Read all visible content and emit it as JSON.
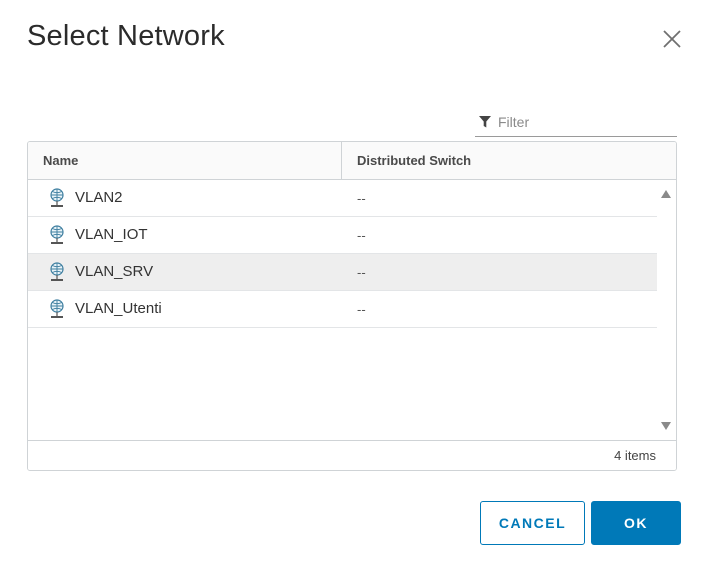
{
  "dialog": {
    "title": "Select Network",
    "close_icon": "close-icon"
  },
  "filter": {
    "placeholder": "Filter",
    "value": "",
    "icon": "filter-icon"
  },
  "table": {
    "columns": [
      "Name",
      "Distributed Switch"
    ],
    "rows": [
      {
        "name": "VLAN2",
        "switch": "--",
        "icon": "network-icon",
        "selected": false
      },
      {
        "name": "VLAN_IOT",
        "switch": "--",
        "icon": "network-icon",
        "selected": false
      },
      {
        "name": "VLAN_SRV",
        "switch": "--",
        "icon": "network-icon",
        "selected": true
      },
      {
        "name": "VLAN_Utenti",
        "switch": "--",
        "icon": "network-icon",
        "selected": false
      }
    ],
    "footer_count": "4 items"
  },
  "buttons": {
    "cancel_label": "CANCEL",
    "ok_label": "OK"
  },
  "colors": {
    "accent": "#0079b8",
    "selected_row": "#eeeeee"
  }
}
